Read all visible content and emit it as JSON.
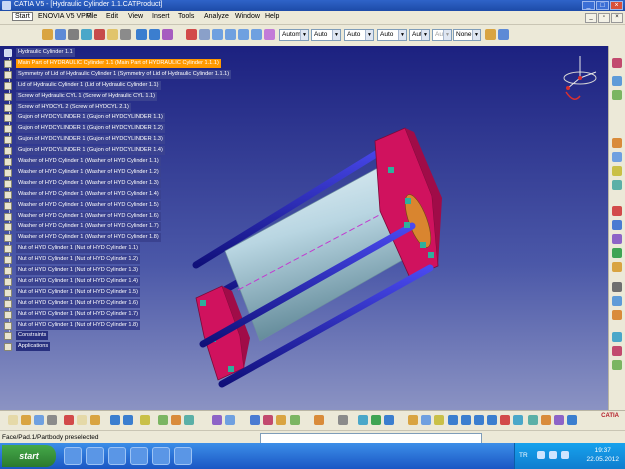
{
  "window": {
    "title": "CATIA V5 - [Hydraulic Cylinder 1.1.CATProduct]"
  },
  "menu": {
    "items": [
      "Start",
      "ENOVIA V5 VPM",
      "File",
      "Edit",
      "View",
      "Insert",
      "Tools",
      "Analyze",
      "Window",
      "Help"
    ]
  },
  "toolbar": {
    "combos": [
      "Autom·",
      "Auto",
      "Auto",
      "Auto",
      "Aut",
      "Aut",
      "None"
    ]
  },
  "tree": {
    "nodes": [
      {
        "label": "Hydraulic Cylinder 1.1",
        "kind": "top"
      },
      {
        "label": "Main Part of HYDRAULIC Cylinder 1.1 (Main Part of HYDRAULIC Cylinder 1.1.1)",
        "kind": "selected"
      },
      {
        "label": "Symmetry of Lid of Hydraulic Cylinder 1 (Symmetry of Lid of Hydraulic Cylinder 1.1.1)",
        "kind": "part"
      },
      {
        "label": "Lid of Hydraulic Cylinder 1 (Lid of Hydraulic Cylinder 1.1)",
        "kind": "part"
      },
      {
        "label": "Screw of Hydraulic CYL 1 (Screw of Hydraulic CYL 1.1)",
        "kind": "part"
      },
      {
        "label": "Screw of HYDCYL 2 (Screw of HYDCYL 2.1)",
        "kind": "part"
      },
      {
        "label": "Gujon of HYDCYLINDER 1 (Gujon of HYDCYLINDER 1.1)",
        "kind": "part"
      },
      {
        "label": "Gujon of HYDCYLINDER 1 (Gujon of HYDCYLINDER 1.2)",
        "kind": "part"
      },
      {
        "label": "Gujon of HYDCYLINDER 1 (Gujon of HYDCYLINDER 1.3)",
        "kind": "part"
      },
      {
        "label": "Gujon of HYDCYLINDER 1 (Gujon of HYDCYLINDER 1.4)",
        "kind": "part"
      },
      {
        "label": "Washer of HYD Cylinder 1 (Washer of HYD Cylinder 1.1)",
        "kind": "part"
      },
      {
        "label": "Washer of HYD Cylinder 1 (Washer of HYD Cylinder 1.2)",
        "kind": "part"
      },
      {
        "label": "Washer of HYD Cylinder 1 (Washer of HYD Cylinder 1.3)",
        "kind": "part"
      },
      {
        "label": "Washer of HYD Cylinder 1 (Washer of HYD Cylinder 1.4)",
        "kind": "part"
      },
      {
        "label": "Washer of HYD Cylinder 1 (Washer of HYD Cylinder 1.5)",
        "kind": "part"
      },
      {
        "label": "Washer of HYD Cylinder 1 (Washer of HYD Cylinder 1.6)",
        "kind": "part"
      },
      {
        "label": "Washer of HYD Cylinder 1 (Washer of HYD Cylinder 1.7)",
        "kind": "part"
      },
      {
        "label": "Washer of HYD Cylinder 1 (Washer of HYD Cylinder 1.8)",
        "kind": "part"
      },
      {
        "label": "Nut of HYD Cylinder 1 (Nut of HYD Cylinder 1.1)",
        "kind": "part"
      },
      {
        "label": "Nut of HYD Cylinder 1 (Nut of HYD Cylinder 1.2)",
        "kind": "part"
      },
      {
        "label": "Nut of HYD Cylinder 1 (Nut of HYD Cylinder 1.3)",
        "kind": "part"
      },
      {
        "label": "Nut of HYD Cylinder 1 (Nut of HYD Cylinder 1.4)",
        "kind": "part"
      },
      {
        "label": "Nut of HYD Cylinder 1 (Nut of HYD Cylinder 1.5)",
        "kind": "part"
      },
      {
        "label": "Nut of HYD Cylinder 1 (Nut of HYD Cylinder 1.6)",
        "kind": "part"
      },
      {
        "label": "Nut of HYD Cylinder 1 (Nut of HYD Cylinder 1.7)",
        "kind": "part"
      },
      {
        "label": "Nut of HYD Cylinder 1 (Nut of HYD Cylinder 1.8)",
        "kind": "part"
      },
      {
        "label": "Constraints",
        "kind": "plain"
      },
      {
        "label": "Applications",
        "kind": "plain"
      }
    ]
  },
  "status": {
    "text": "Face/Pad.1/Partbody preselected"
  },
  "taskbar": {
    "start_label": "start",
    "tray_lang": "TR",
    "clock_time": "19:37",
    "clock_date": "22.05.2012"
  },
  "colors": {
    "viewport_top": "#1c2180",
    "viewport_bottom": "#8b93c3",
    "tree_selected": "#ff9900",
    "flange": "#d0125e",
    "rod": "#1a1aa8",
    "cylinder": "#b9d6e2"
  }
}
